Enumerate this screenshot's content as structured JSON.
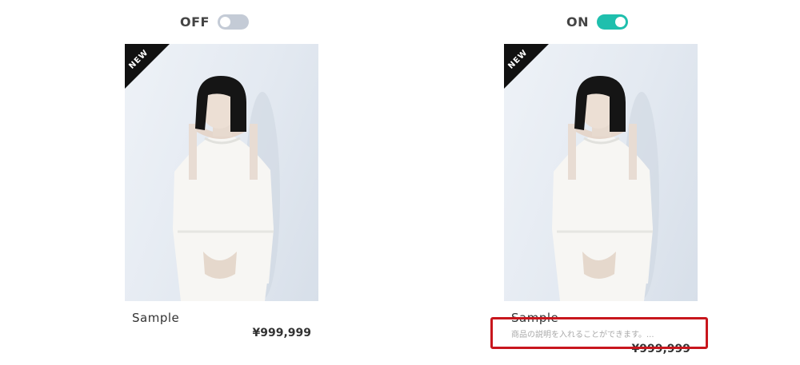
{
  "left_panel": {
    "toggle_label": "OFF",
    "toggle_state": "off",
    "badge": "NEW",
    "product_name": "Sample",
    "price": "¥999,999",
    "image": "model-photo"
  },
  "right_panel": {
    "toggle_label": "ON",
    "toggle_state": "on",
    "badge": "NEW",
    "product_name": "Sample",
    "description": "商品の説明を入れることができます。...",
    "price": "¥999,999",
    "image": "model-photo"
  },
  "colors": {
    "toggle_on": "#1fbfad",
    "toggle_off": "#c4cbd6",
    "ribbon": "#111111",
    "highlight": "#c8161d"
  }
}
